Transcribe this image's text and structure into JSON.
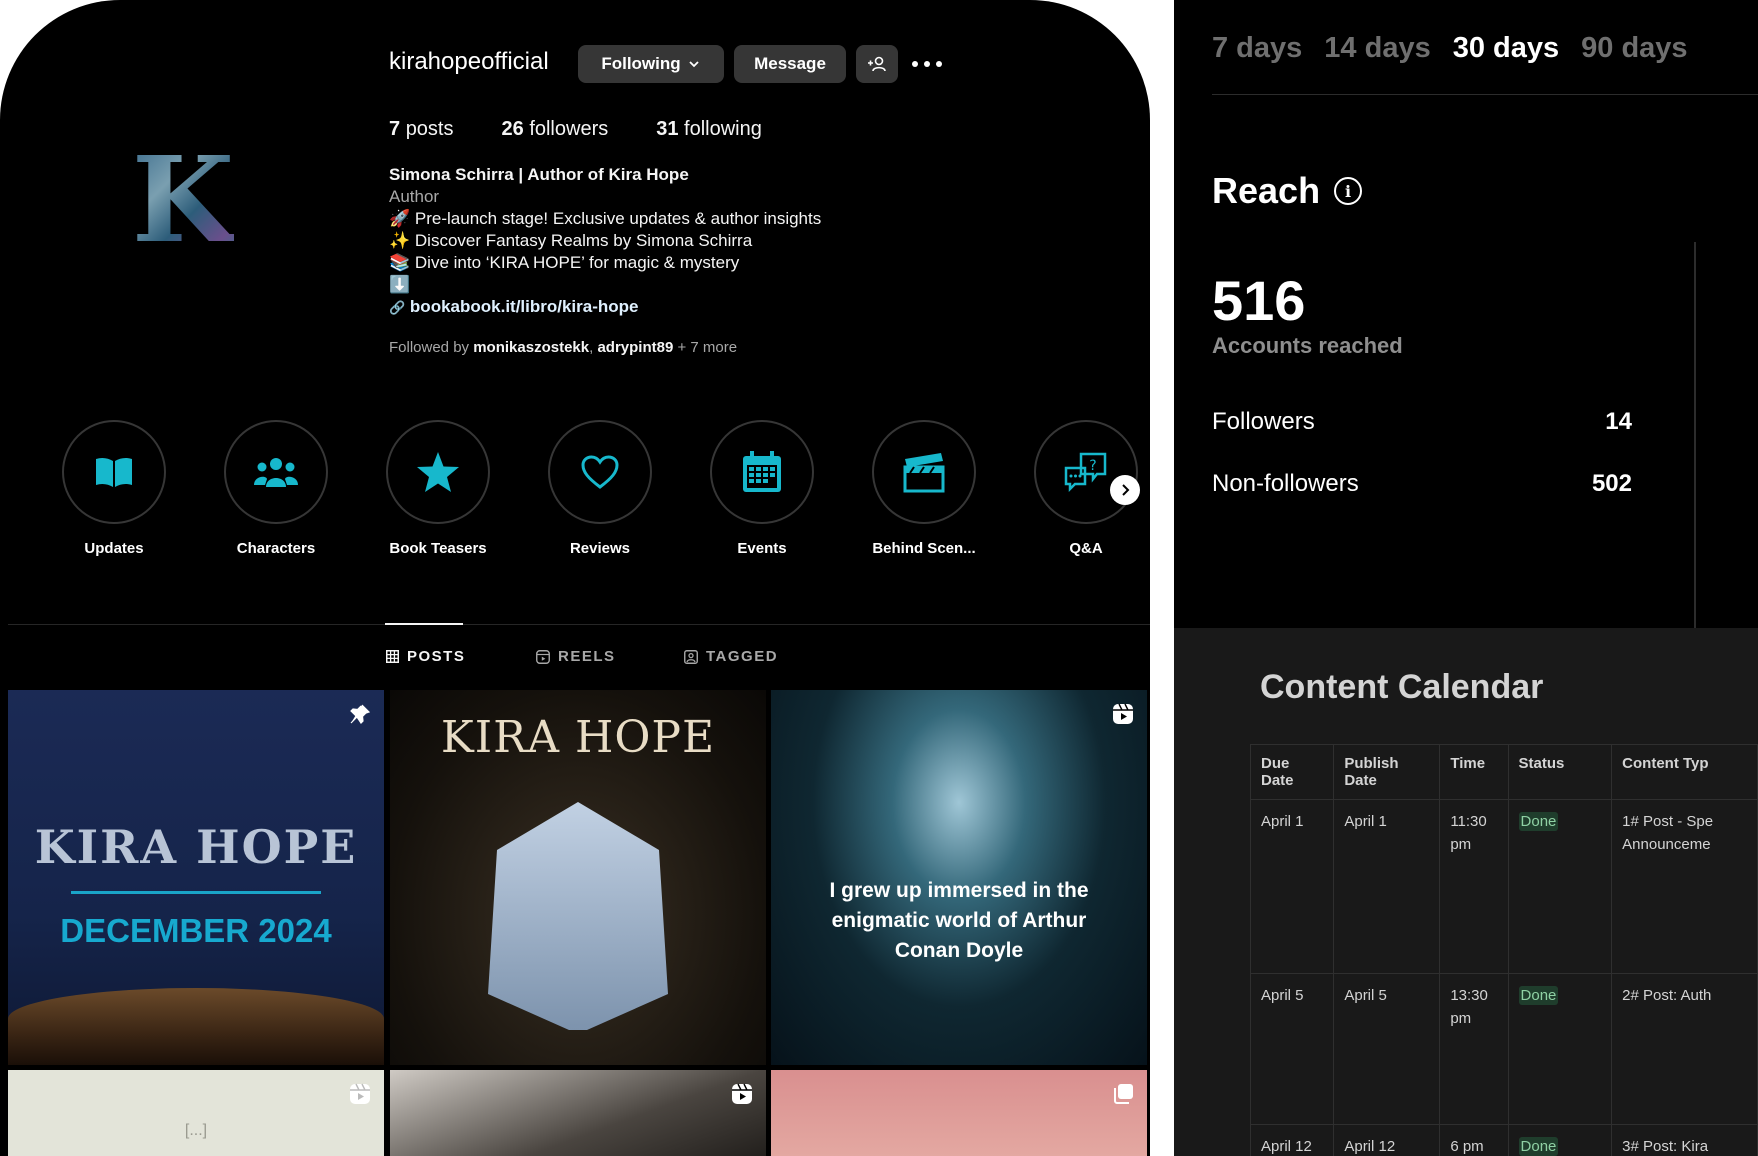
{
  "profile": {
    "username": "kirahopeofficial",
    "avatar_letter": "K",
    "buttons": {
      "following": "Following",
      "message": "Message"
    },
    "stats": [
      {
        "value": "7",
        "label": "posts"
      },
      {
        "value": "26",
        "label": "followers"
      },
      {
        "value": "31",
        "label": "following"
      }
    ],
    "bio": {
      "name": "Simona Schirra | Author of Kira Hope",
      "category": "Author",
      "line1": "🚀 Pre-launch stage! Exclusive updates & author insights",
      "line2": "✨ Discover Fantasy Realms by Simona Schirra",
      "line3": "📚 Dive into ‘KIRA HOPE’ for magic & mystery",
      "line4": "⬇️",
      "link": "bookabook.it/libro/kira-hope"
    },
    "followed_by": {
      "prefix": "Followed by ",
      "user1": "monikaszostekk",
      "sep": ", ",
      "user2": "adrypint89",
      "suffix": " + 7 more"
    },
    "highlights": [
      {
        "label": "Updates",
        "icon": "book-icon"
      },
      {
        "label": "Characters",
        "icon": "people-icon"
      },
      {
        "label": "Book Teasers",
        "icon": "star-icon"
      },
      {
        "label": "Reviews",
        "icon": "heart-icon"
      },
      {
        "label": "Events",
        "icon": "calendar-icon"
      },
      {
        "label": "Behind Scen...",
        "icon": "clapperboard-icon"
      },
      {
        "label": "Q&A",
        "icon": "chat-question-icon"
      }
    ],
    "tabs": {
      "posts": "POSTS",
      "reels": "REELS",
      "tagged": "TAGGED"
    },
    "posts": {
      "p1_title": "KIRA HOPE",
      "p1_sub": "DECEMBER 2024",
      "p2_title": "KIRA HOPE",
      "p3_text": "I grew up immersed in the enigmatic world of Arthur Conan Doyle",
      "p4_text": "[...]"
    },
    "colors": {
      "accent": "#17b8cc",
      "background": "#000000"
    }
  },
  "insights": {
    "ranges": [
      "7 days",
      "14 days",
      "30 days",
      "90 days"
    ],
    "active_range": "30 days",
    "reach_title": "Reach",
    "accounts_reached": "516",
    "accounts_reached_label": "Accounts reached",
    "metrics": [
      {
        "label": "Followers",
        "value": "14"
      },
      {
        "label": "Non-followers",
        "value": "502"
      }
    ]
  },
  "calendar": {
    "title": "Content Calendar",
    "headers": [
      "Due Date",
      "Publish Date",
      "Time",
      "Status",
      "Content Typ"
    ],
    "rows": [
      {
        "due": "April 1",
        "publish": "April 1",
        "time": "11:30 pm",
        "status": "Done",
        "type": "1# Post - Spe",
        "type2": "Announceme"
      },
      {
        "due": "April 5",
        "publish": "April 5",
        "time": "13:30 pm",
        "status": "Done",
        "type": "2# Post: Auth",
        "type2": ""
      },
      {
        "due": "April 12",
        "publish": "April 12",
        "time": "6 pm",
        "status": "Done",
        "type": "3#  Post: Kira",
        "type2": ""
      }
    ]
  }
}
